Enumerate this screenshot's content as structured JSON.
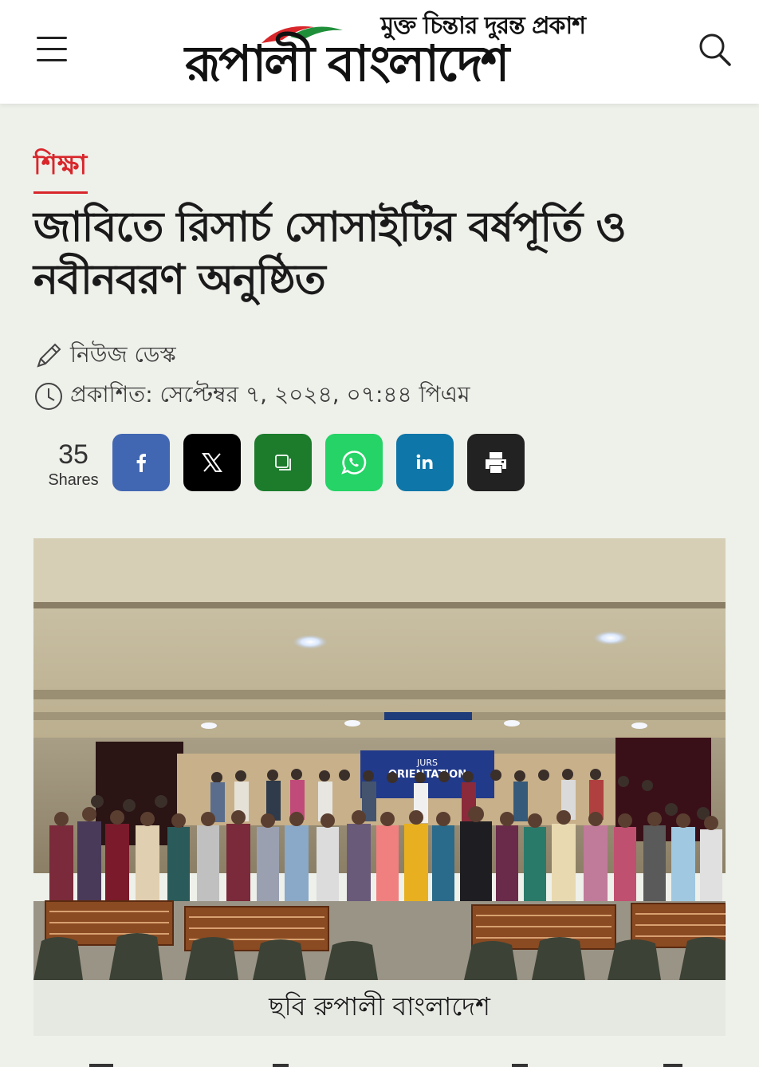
{
  "header": {
    "logo_tagline": "মুক্ত চিন্তার দুরন্ত প্রকাশ",
    "logo_title": "রূপালী বাংলাদেশ",
    "menu_icon": "hamburger-menu-icon",
    "search_icon": "search-icon"
  },
  "article": {
    "category": "শিক্ষা",
    "headline": "জাবিতে রিসার্চ সোসাইটির বর্ষপূর্তি ও নবীনবরণ অনুষ্ঠিত",
    "author": "নিউজ ডেস্ক",
    "published": "প্রকাশিত: সেপ্টেম্বর ৭, ২০২৪, ০৭:৪৪ পিএম",
    "photo_banner": "JURS ORIENTATION",
    "photo_caption": "ছবি রুপালী বাংলাদেশ"
  },
  "share": {
    "count": "35",
    "label": "Shares",
    "buttons": [
      {
        "name": "facebook",
        "icon": "facebook-icon",
        "color": "#4267b2"
      },
      {
        "name": "x",
        "icon": "x-icon",
        "color": "#000000"
      },
      {
        "name": "copy",
        "icon": "copy-icon",
        "color": "#1c7c2c"
      },
      {
        "name": "whatsapp",
        "icon": "whatsapp-icon",
        "color": "#25d366"
      },
      {
        "name": "linkedin",
        "icon": "linkedin-icon",
        "color": "#0e76a8"
      },
      {
        "name": "print",
        "icon": "print-icon",
        "color": "#222222"
      }
    ]
  },
  "colors": {
    "accent": "#d8262b",
    "page_bg": "#eef0ea"
  }
}
